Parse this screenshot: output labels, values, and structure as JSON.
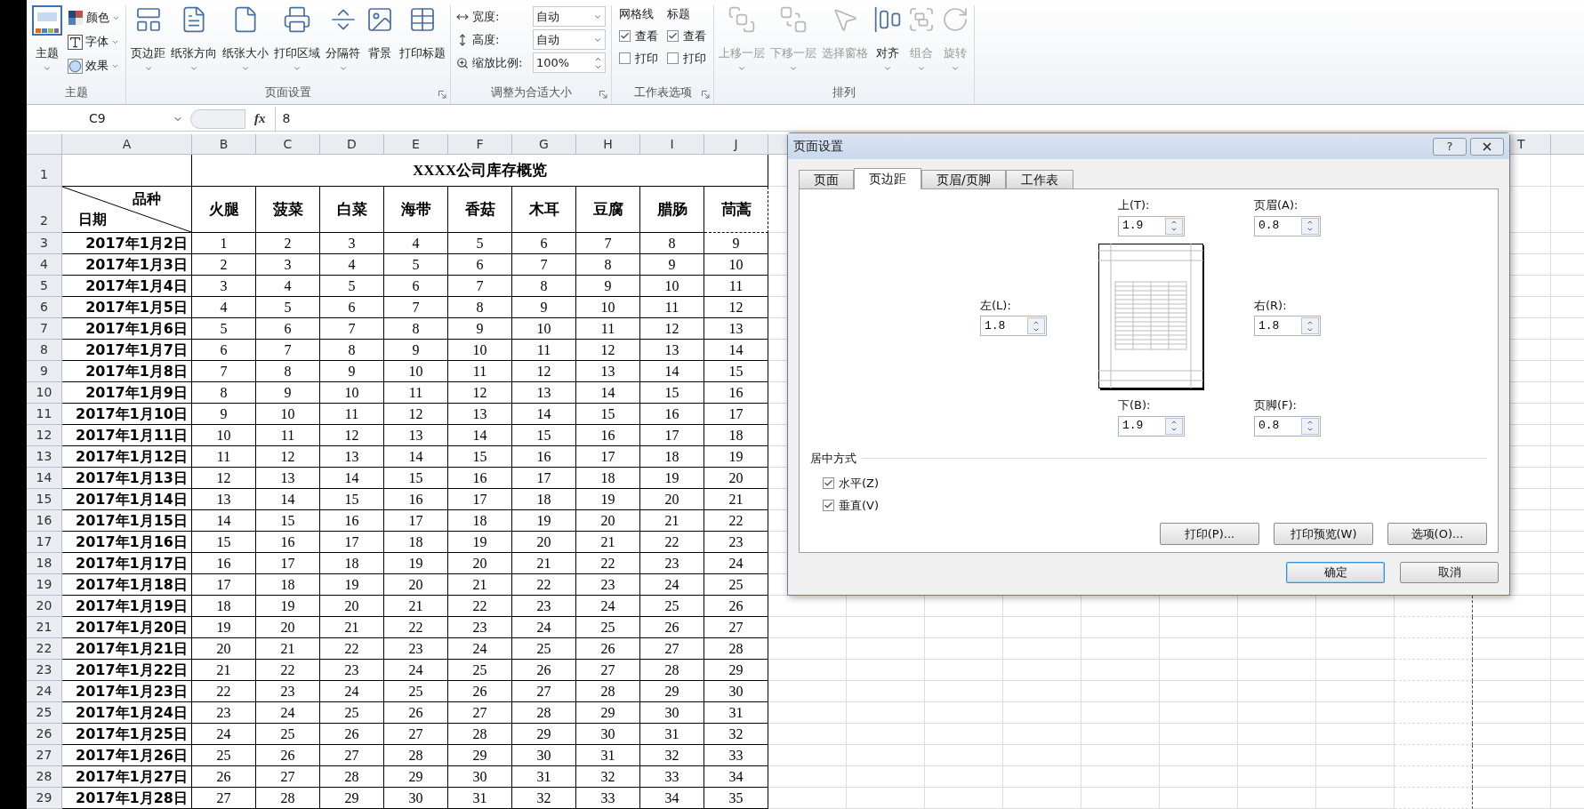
{
  "ribbon": {
    "groups": [
      {
        "label": "主题",
        "kind": "theme",
        "launcher": false,
        "large": {
          "label": "主题",
          "dropdown": true
        },
        "small": [
          {
            "label": "颜色"
          },
          {
            "label": "字体"
          },
          {
            "label": "效果"
          }
        ]
      },
      {
        "label": "页面设置",
        "kind": "buttons",
        "launcher": true,
        "buttons": [
          {
            "label": "页边距",
            "dropdown": true,
            "disabled": false
          },
          {
            "label": "纸张方向",
            "dropdown": true,
            "disabled": false
          },
          {
            "label": "纸张大小",
            "dropdown": true,
            "disabled": false
          },
          {
            "label": "打印区域",
            "dropdown": true,
            "disabled": false
          },
          {
            "label": "分隔符",
            "dropdown": true,
            "disabled": false
          },
          {
            "label": "背景",
            "dropdown": false,
            "disabled": false
          },
          {
            "label": "打印标题",
            "dropdown": false,
            "disabled": false
          }
        ]
      },
      {
        "label": "调整为合适大小",
        "kind": "fit",
        "launcher": true,
        "fields": [
          {
            "label": "宽度:",
            "value": "自动",
            "kind": "dropdown"
          },
          {
            "label": "高度:",
            "value": "自动",
            "kind": "dropdown"
          },
          {
            "label": "缩放比例:",
            "value": "100%",
            "kind": "spinner"
          }
        ]
      },
      {
        "label": "工作表选项",
        "kind": "options",
        "launcher": true,
        "columns": [
          {
            "title": "网格线",
            "options": [
              {
                "label": "查看",
                "checked": true
              },
              {
                "label": "打印",
                "checked": false
              }
            ]
          },
          {
            "title": "标题",
            "options": [
              {
                "label": "查看",
                "checked": true
              },
              {
                "label": "打印",
                "checked": false
              }
            ]
          }
        ]
      },
      {
        "label": "排列",
        "kind": "buttons",
        "launcher": false,
        "buttons": [
          {
            "label": "上移一层",
            "dropdown": true,
            "disabled": true
          },
          {
            "label": "下移一层",
            "dropdown": true,
            "disabled": true
          },
          {
            "label": "选择窗格",
            "dropdown": false,
            "disabled": true
          },
          {
            "label": "对齐",
            "dropdown": true,
            "disabled": false
          },
          {
            "label": "组合",
            "dropdown": true,
            "disabled": true
          },
          {
            "label": "旋转",
            "dropdown": true,
            "disabled": true
          }
        ]
      }
    ]
  },
  "formula_bar": {
    "name_box": "C9",
    "fx": "fx",
    "value": "8"
  },
  "sheet": {
    "column_headers": [
      "A",
      "B",
      "C",
      "D",
      "E",
      "F",
      "G",
      "H",
      "I",
      "J"
    ],
    "far_column_header": "T",
    "title_row": {
      "number": "1",
      "title": "XXXX公司库存概览"
    },
    "header_row": {
      "number": "2",
      "corner_top": "品种",
      "corner_bottom": "日期",
      "items": [
        "火腿",
        "菠菜",
        "白菜",
        "海带",
        "香菇",
        "木耳",
        "豆腐",
        "腊肠",
        "茼蒿"
      ]
    },
    "data_rows": [
      {
        "number": "3",
        "date": "2017年1月2日",
        "values": [
          "1",
          "2",
          "3",
          "4",
          "5",
          "6",
          "7",
          "8",
          "9"
        ]
      },
      {
        "number": "4",
        "date": "2017年1月3日",
        "values": [
          "2",
          "3",
          "4",
          "5",
          "6",
          "7",
          "8",
          "9",
          "10"
        ]
      },
      {
        "number": "5",
        "date": "2017年1月4日",
        "values": [
          "3",
          "4",
          "5",
          "6",
          "7",
          "8",
          "9",
          "10",
          "11"
        ]
      },
      {
        "number": "6",
        "date": "2017年1月5日",
        "values": [
          "4",
          "5",
          "6",
          "7",
          "8",
          "9",
          "10",
          "11",
          "12"
        ]
      },
      {
        "number": "7",
        "date": "2017年1月6日",
        "values": [
          "5",
          "6",
          "7",
          "8",
          "9",
          "10",
          "11",
          "12",
          "13"
        ]
      },
      {
        "number": "8",
        "date": "2017年1月7日",
        "values": [
          "6",
          "7",
          "8",
          "9",
          "10",
          "11",
          "12",
          "13",
          "14"
        ]
      },
      {
        "number": "9",
        "date": "2017年1月8日",
        "values": [
          "7",
          "8",
          "9",
          "10",
          "11",
          "12",
          "13",
          "14",
          "15"
        ]
      },
      {
        "number": "10",
        "date": "2017年1月9日",
        "values": [
          "8",
          "9",
          "10",
          "11",
          "12",
          "13",
          "14",
          "15",
          "16"
        ]
      },
      {
        "number": "11",
        "date": "2017年1月10日",
        "values": [
          "9",
          "10",
          "11",
          "12",
          "13",
          "14",
          "15",
          "16",
          "17"
        ]
      },
      {
        "number": "12",
        "date": "2017年1月11日",
        "values": [
          "10",
          "11",
          "12",
          "13",
          "14",
          "15",
          "16",
          "17",
          "18"
        ]
      },
      {
        "number": "13",
        "date": "2017年1月12日",
        "values": [
          "11",
          "12",
          "13",
          "14",
          "15",
          "16",
          "17",
          "18",
          "19"
        ]
      },
      {
        "number": "14",
        "date": "2017年1月13日",
        "values": [
          "12",
          "13",
          "14",
          "15",
          "16",
          "17",
          "18",
          "19",
          "20"
        ]
      },
      {
        "number": "15",
        "date": "2017年1月14日",
        "values": [
          "13",
          "14",
          "15",
          "16",
          "17",
          "18",
          "19",
          "20",
          "21"
        ]
      },
      {
        "number": "16",
        "date": "2017年1月15日",
        "values": [
          "14",
          "15",
          "16",
          "17",
          "18",
          "19",
          "20",
          "21",
          "22"
        ]
      },
      {
        "number": "17",
        "date": "2017年1月16日",
        "values": [
          "15",
          "16",
          "17",
          "18",
          "19",
          "20",
          "21",
          "22",
          "23"
        ]
      },
      {
        "number": "18",
        "date": "2017年1月17日",
        "values": [
          "16",
          "17",
          "18",
          "19",
          "20",
          "21",
          "22",
          "23",
          "24"
        ]
      },
      {
        "number": "19",
        "date": "2017年1月18日",
        "values": [
          "17",
          "18",
          "19",
          "20",
          "21",
          "22",
          "23",
          "24",
          "25"
        ]
      },
      {
        "number": "20",
        "date": "2017年1月19日",
        "values": [
          "18",
          "19",
          "20",
          "21",
          "22",
          "23",
          "24",
          "25",
          "26"
        ]
      },
      {
        "number": "21",
        "date": "2017年1月20日",
        "values": [
          "19",
          "20",
          "21",
          "22",
          "23",
          "24",
          "25",
          "26",
          "27"
        ]
      },
      {
        "number": "22",
        "date": "2017年1月21日",
        "values": [
          "20",
          "21",
          "22",
          "23",
          "24",
          "25",
          "26",
          "27",
          "28"
        ]
      },
      {
        "number": "23",
        "date": "2017年1月22日",
        "values": [
          "21",
          "22",
          "23",
          "24",
          "25",
          "26",
          "27",
          "28",
          "29"
        ]
      },
      {
        "number": "24",
        "date": "2017年1月23日",
        "values": [
          "22",
          "23",
          "24",
          "25",
          "26",
          "27",
          "28",
          "29",
          "30"
        ]
      },
      {
        "number": "25",
        "date": "2017年1月24日",
        "values": [
          "23",
          "24",
          "25",
          "26",
          "27",
          "28",
          "29",
          "30",
          "31"
        ]
      },
      {
        "number": "26",
        "date": "2017年1月25日",
        "values": [
          "24",
          "25",
          "26",
          "27",
          "28",
          "29",
          "30",
          "31",
          "32"
        ]
      },
      {
        "number": "27",
        "date": "2017年1月26日",
        "values": [
          "25",
          "26",
          "27",
          "28",
          "29",
          "30",
          "31",
          "32",
          "33"
        ]
      },
      {
        "number": "28",
        "date": "2017年1月27日",
        "values": [
          "26",
          "27",
          "28",
          "29",
          "30",
          "31",
          "32",
          "33",
          "34"
        ]
      },
      {
        "number": "29",
        "date": "2017年1月28日",
        "values": [
          "27",
          "28",
          "29",
          "30",
          "31",
          "32",
          "33",
          "34",
          "35"
        ]
      }
    ]
  },
  "dialog": {
    "title": "页面设置",
    "help": "?",
    "tabs": [
      {
        "label": "页面",
        "selected": false
      },
      {
        "label": "页边距",
        "selected": true
      },
      {
        "label": "页眉/页脚",
        "selected": false
      },
      {
        "label": "工作表",
        "selected": false
      }
    ],
    "fields": [
      {
        "kind": "top",
        "label": "上(T):",
        "value": "1.9"
      },
      {
        "kind": "header",
        "label": "页眉(A):",
        "value": "0.8"
      },
      {
        "kind": "left",
        "label": "左(L):",
        "value": "1.8"
      },
      {
        "kind": "right",
        "label": "右(R):",
        "value": "1.8"
      },
      {
        "kind": "bottom",
        "label": "下(B):",
        "value": "1.9"
      },
      {
        "kind": "footer",
        "label": "页脚(F):",
        "value": "0.8"
      }
    ],
    "centering": {
      "title": "居中方式",
      "options": [
        {
          "label": "水平(Z)",
          "checked": true
        },
        {
          "label": "垂直(V)",
          "checked": true
        }
      ]
    },
    "action_buttons": [
      "打印(P)...",
      "打印预览(W)",
      "选项(O)..."
    ],
    "footer_buttons": [
      {
        "label": "确定",
        "default": true
      },
      {
        "label": "取消",
        "default": false
      }
    ]
  }
}
